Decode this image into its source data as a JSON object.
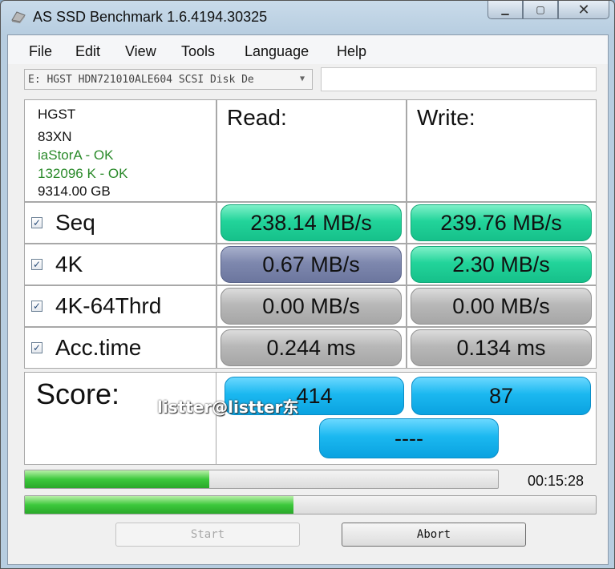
{
  "window": {
    "title": "AS SSD Benchmark 1.6.4194.30325"
  },
  "menu": [
    "File",
    "Edit",
    "View",
    "Tools",
    "Language",
    "Help"
  ],
  "drive_select": {
    "value": "E: HGST HDN721010ALE604 SCSI Disk De"
  },
  "drive_info": {
    "vendor": "HGST",
    "firmware": "83XN",
    "driver": "iaStorA - OK",
    "alignment": "132096 K - OK",
    "size": "9314.00 GB"
  },
  "columns": {
    "read": "Read:",
    "write": "Write:"
  },
  "rows": [
    {
      "label": "Seq",
      "checked": true,
      "read": "238.14 MB/s",
      "write": "239.76 MB/s"
    },
    {
      "label": "4K",
      "checked": true,
      "read": "0.67 MB/s",
      "write": "2.30 MB/s"
    },
    {
      "label": "4K-64Thrd",
      "checked": true,
      "read": "0.00 MB/s",
      "write": "0.00 MB/s"
    },
    {
      "label": "Acc.time",
      "checked": true,
      "read": "0.244 ms",
      "write": "0.134 ms"
    }
  ],
  "score": {
    "label": "Score:",
    "read": "414",
    "write": "87",
    "total": "----"
  },
  "watermark": "listter@listter东",
  "progress": {
    "top_fraction": 0.39,
    "bottom_fraction": 0.47,
    "elapsed": "00:15:28"
  },
  "buttons": {
    "start": "Start",
    "abort": "Abort"
  },
  "colors": {
    "green": "#22d49a",
    "slate": "#7e88ae",
    "gray": "#b8b8b8",
    "blue": "#1bb8f0",
    "ok_text": "#2a8a2a"
  },
  "icons": {
    "app": "hard-disk-icon",
    "check": "checkmark-icon",
    "dropdown": "chevron-down-icon"
  }
}
